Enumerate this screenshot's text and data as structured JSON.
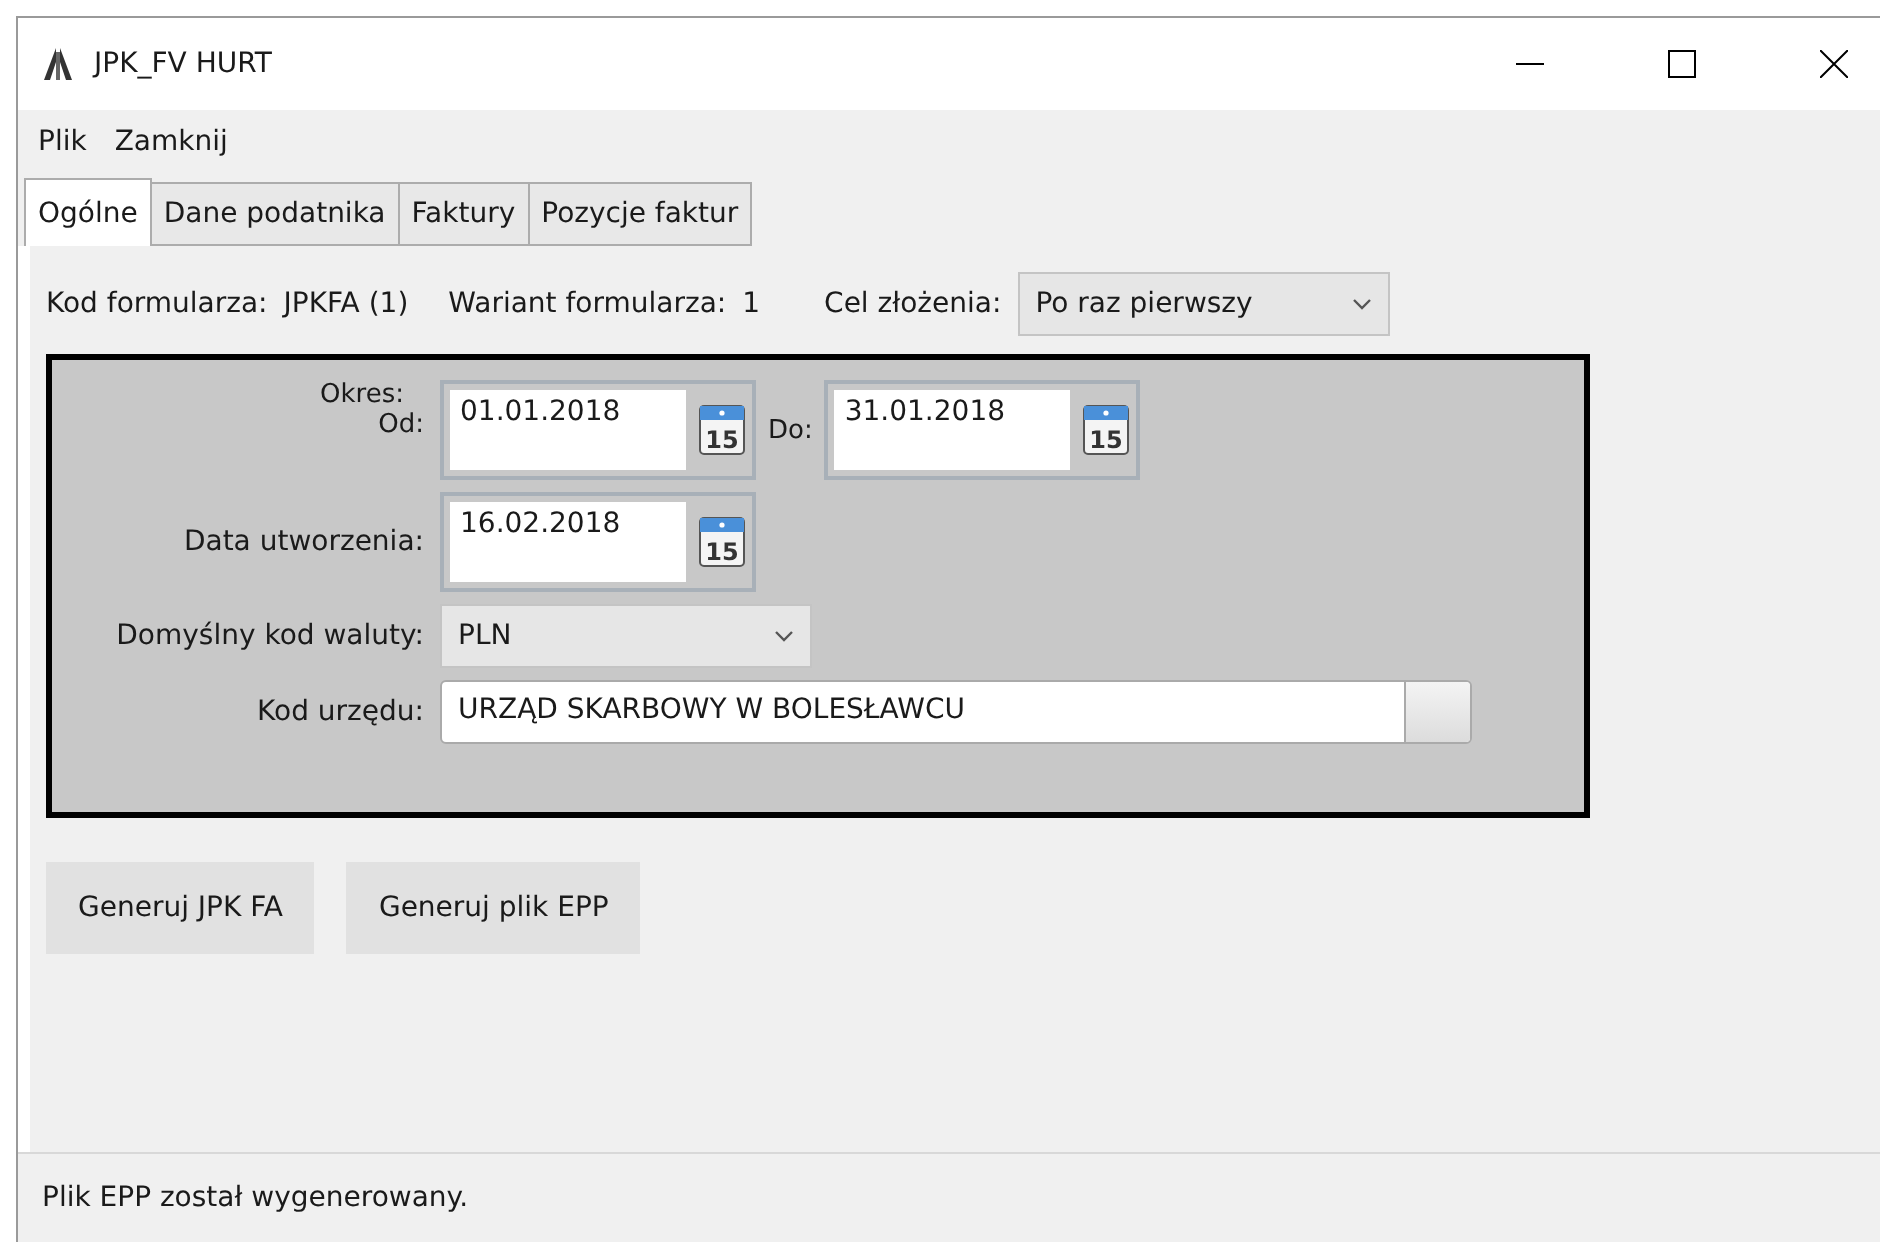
{
  "window": {
    "title": "JPK_FV HURT"
  },
  "menu": [
    "Plik",
    "Zamknij"
  ],
  "tabs": [
    {
      "label": "Ogólne",
      "selected": true
    },
    {
      "label": "Dane podatnika",
      "selected": false
    },
    {
      "label": "Faktury",
      "selected": false
    },
    {
      "label": "Pozycje faktur",
      "selected": false
    }
  ],
  "header": {
    "form_code_label": "Kod formularza:",
    "form_code": "JPKFA (1)",
    "variant_label": "Wariant formularza:",
    "variant": "1",
    "purpose_label": "Cel złożenia:",
    "purpose": "Po raz pierwszy"
  },
  "period": {
    "label": "Okres:",
    "from_label": "Od:",
    "from": {
      "value": "01.01.2018",
      "icon_label": "15"
    },
    "to_label": "Do:",
    "to": {
      "value": "31.01.2018",
      "icon_label": "15"
    }
  },
  "created": {
    "label": "Data utworzenia:",
    "value": "16.02.2018",
    "icon_label": "15"
  },
  "currency": {
    "label": "Domyślny kod waluty:",
    "value": "PLN"
  },
  "office": {
    "label": "Kod urzędu:",
    "value": "URZĄD SKARBOWY W BOLESŁAWCU"
  },
  "buttons": [
    "Generuj JPK FA",
    "Generuj plik EPP"
  ],
  "status_bar": "Plik EPP został wygenerowany."
}
